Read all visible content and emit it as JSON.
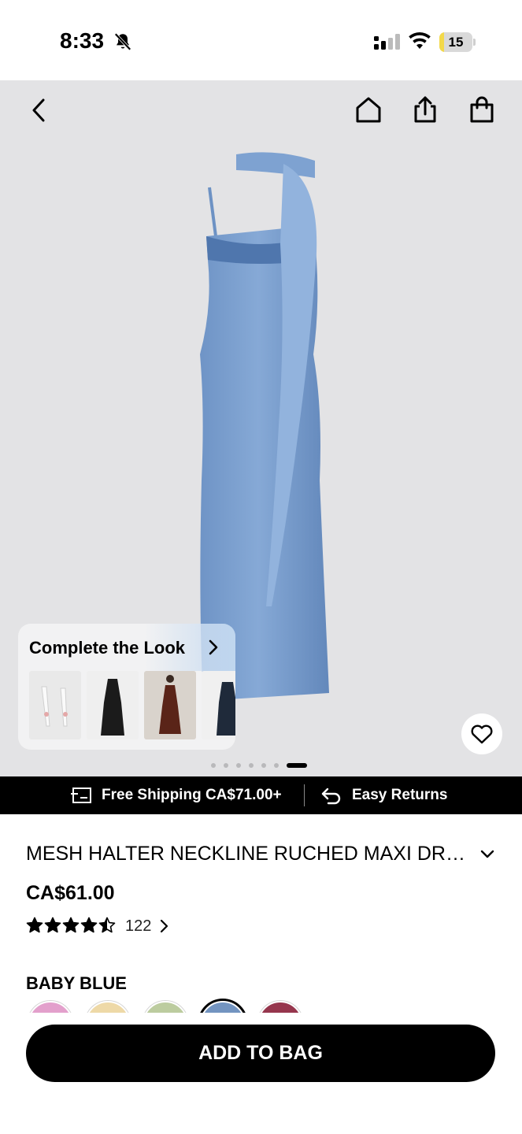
{
  "status_bar": {
    "time": "8:33",
    "battery_level": "15",
    "battery_fill": 0.15,
    "icons": [
      "bell-off-icon",
      "cellular-signal-icon",
      "wifi-icon",
      "battery-icon"
    ]
  },
  "header": {
    "icons": [
      "back-arrow-icon",
      "home-icon",
      "share-icon",
      "shopping-bag-icon"
    ]
  },
  "hero": {
    "background": "#e3e3e5",
    "dress_color": "#7fa3cf",
    "image_count": 7,
    "active_image": 7
  },
  "complete_the_look": {
    "title": "Complete the Look",
    "items": [
      "white-heels-thumbnail",
      "black-satin-dress-thumbnail",
      "brown-halter-dress-thumbnail",
      "navy-slip-dress-thumbnail"
    ]
  },
  "promo_bar": {
    "shipping_text": "Free Shipping CA$71.00+",
    "returns_text": "Easy Returns"
  },
  "product": {
    "title": "MESH HALTER NECKLINE RUCHED MAXI DRESS",
    "price": "CA$61.00",
    "rating": 4.5,
    "review_count": "122",
    "selected_color": "BABY BLUE",
    "swatches": [
      {
        "name": "pink",
        "color": "#e3a0cc"
      },
      {
        "name": "cream",
        "color": "#eed9a7"
      },
      {
        "name": "sage",
        "color": "#bccc9f"
      },
      {
        "name": "baby-blue",
        "color": "#7394c0",
        "selected": true
      },
      {
        "name": "burgundy",
        "color": "#96364d"
      }
    ]
  },
  "cta": {
    "add_to_bag": "ADD TO BAG"
  }
}
